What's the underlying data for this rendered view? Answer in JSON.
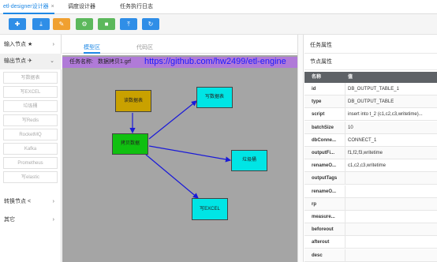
{
  "tabs": [
    {
      "label": "etl-designer设计器",
      "close": "×"
    },
    {
      "label": "调度设计器"
    },
    {
      "label": "任务执行日志"
    }
  ],
  "toolbar": {
    "buttons": [
      {
        "icon": "plus-icon",
        "glyph": "✚",
        "color": "#2f8ee7"
      },
      {
        "icon": "download-icon",
        "glyph": "⤓",
        "color": "#2f8ee7"
      },
      {
        "icon": "edit-icon",
        "glyph": "✎",
        "color": "#f0a030"
      },
      {
        "icon": "play-icon",
        "glyph": "⚙",
        "color": "#5cb85c"
      },
      {
        "icon": "stop-icon",
        "glyph": "■",
        "color": "#5cb85c"
      },
      {
        "icon": "upload-icon",
        "glyph": "⤒",
        "color": "#2f8ee7"
      },
      {
        "icon": "refresh-icon",
        "glyph": "↻",
        "color": "#2f8ee7"
      }
    ]
  },
  "sidebar": {
    "input_group": {
      "label": "输入节点",
      "icon": "★",
      "chevron": "›"
    },
    "output_group": {
      "label": "输出节点",
      "icon": "✈",
      "chevron": "⌄"
    },
    "output_items": [
      "写数据表",
      "写EXCEL",
      "垃圾桶",
      "写Redis",
      "RocketMQ",
      "Kafka",
      "Prometheus",
      "写elastic"
    ],
    "transform_group": {
      "label": "转换节点",
      "icon": "<",
      "chevron": "›"
    },
    "other_group": {
      "label": "其它",
      "chevron": "›"
    }
  },
  "canvas_tabs": {
    "model": "模型区",
    "code": "代码区"
  },
  "task": {
    "label": "任务名称:",
    "name": "数据拷贝1.grf",
    "link": "https://github.com/hw2499/etl-engine"
  },
  "nodes": {
    "read": {
      "label": "读数据表",
      "color": "#c9a100"
    },
    "copy": {
      "label": "拷贝数据",
      "color": "#10c010"
    },
    "write_table": {
      "label": "写数据表",
      "color": "#00e5e5"
    },
    "trash": {
      "label": "垃圾桶",
      "color": "#00e5e5"
    },
    "excel": {
      "label": "写EXCEL",
      "color": "#00e5e5"
    }
  },
  "panel": {
    "task_props_title": "任务属性",
    "node_props_title": "节点属性",
    "col_name": "名称",
    "col_value": "值",
    "props": [
      {
        "name": "id",
        "value": "DB_OUTPUT_TABLE_1"
      },
      {
        "name": "type",
        "value": "DB_OUTPUT_TABLE"
      },
      {
        "name": "script",
        "value": "insert into t_2 (c1,c2,c3,writetime)..."
      },
      {
        "name": "batchSize",
        "value": "10"
      },
      {
        "name": "dbConne...",
        "value": "CONNECT_1"
      },
      {
        "name": "outputFi...",
        "value": "f1,f2,f3,writetime"
      },
      {
        "name": "renameO...",
        "value": "c1,c2,c3,writetime"
      },
      {
        "name": "outputTags",
        "value": ""
      },
      {
        "name": "renameO...",
        "value": ""
      },
      {
        "name": "rp",
        "value": ""
      },
      {
        "name": "measure...",
        "value": ""
      },
      {
        "name": "beforeout",
        "value": ""
      },
      {
        "name": "afterout",
        "value": ""
      },
      {
        "name": "desc",
        "value": ""
      }
    ]
  }
}
